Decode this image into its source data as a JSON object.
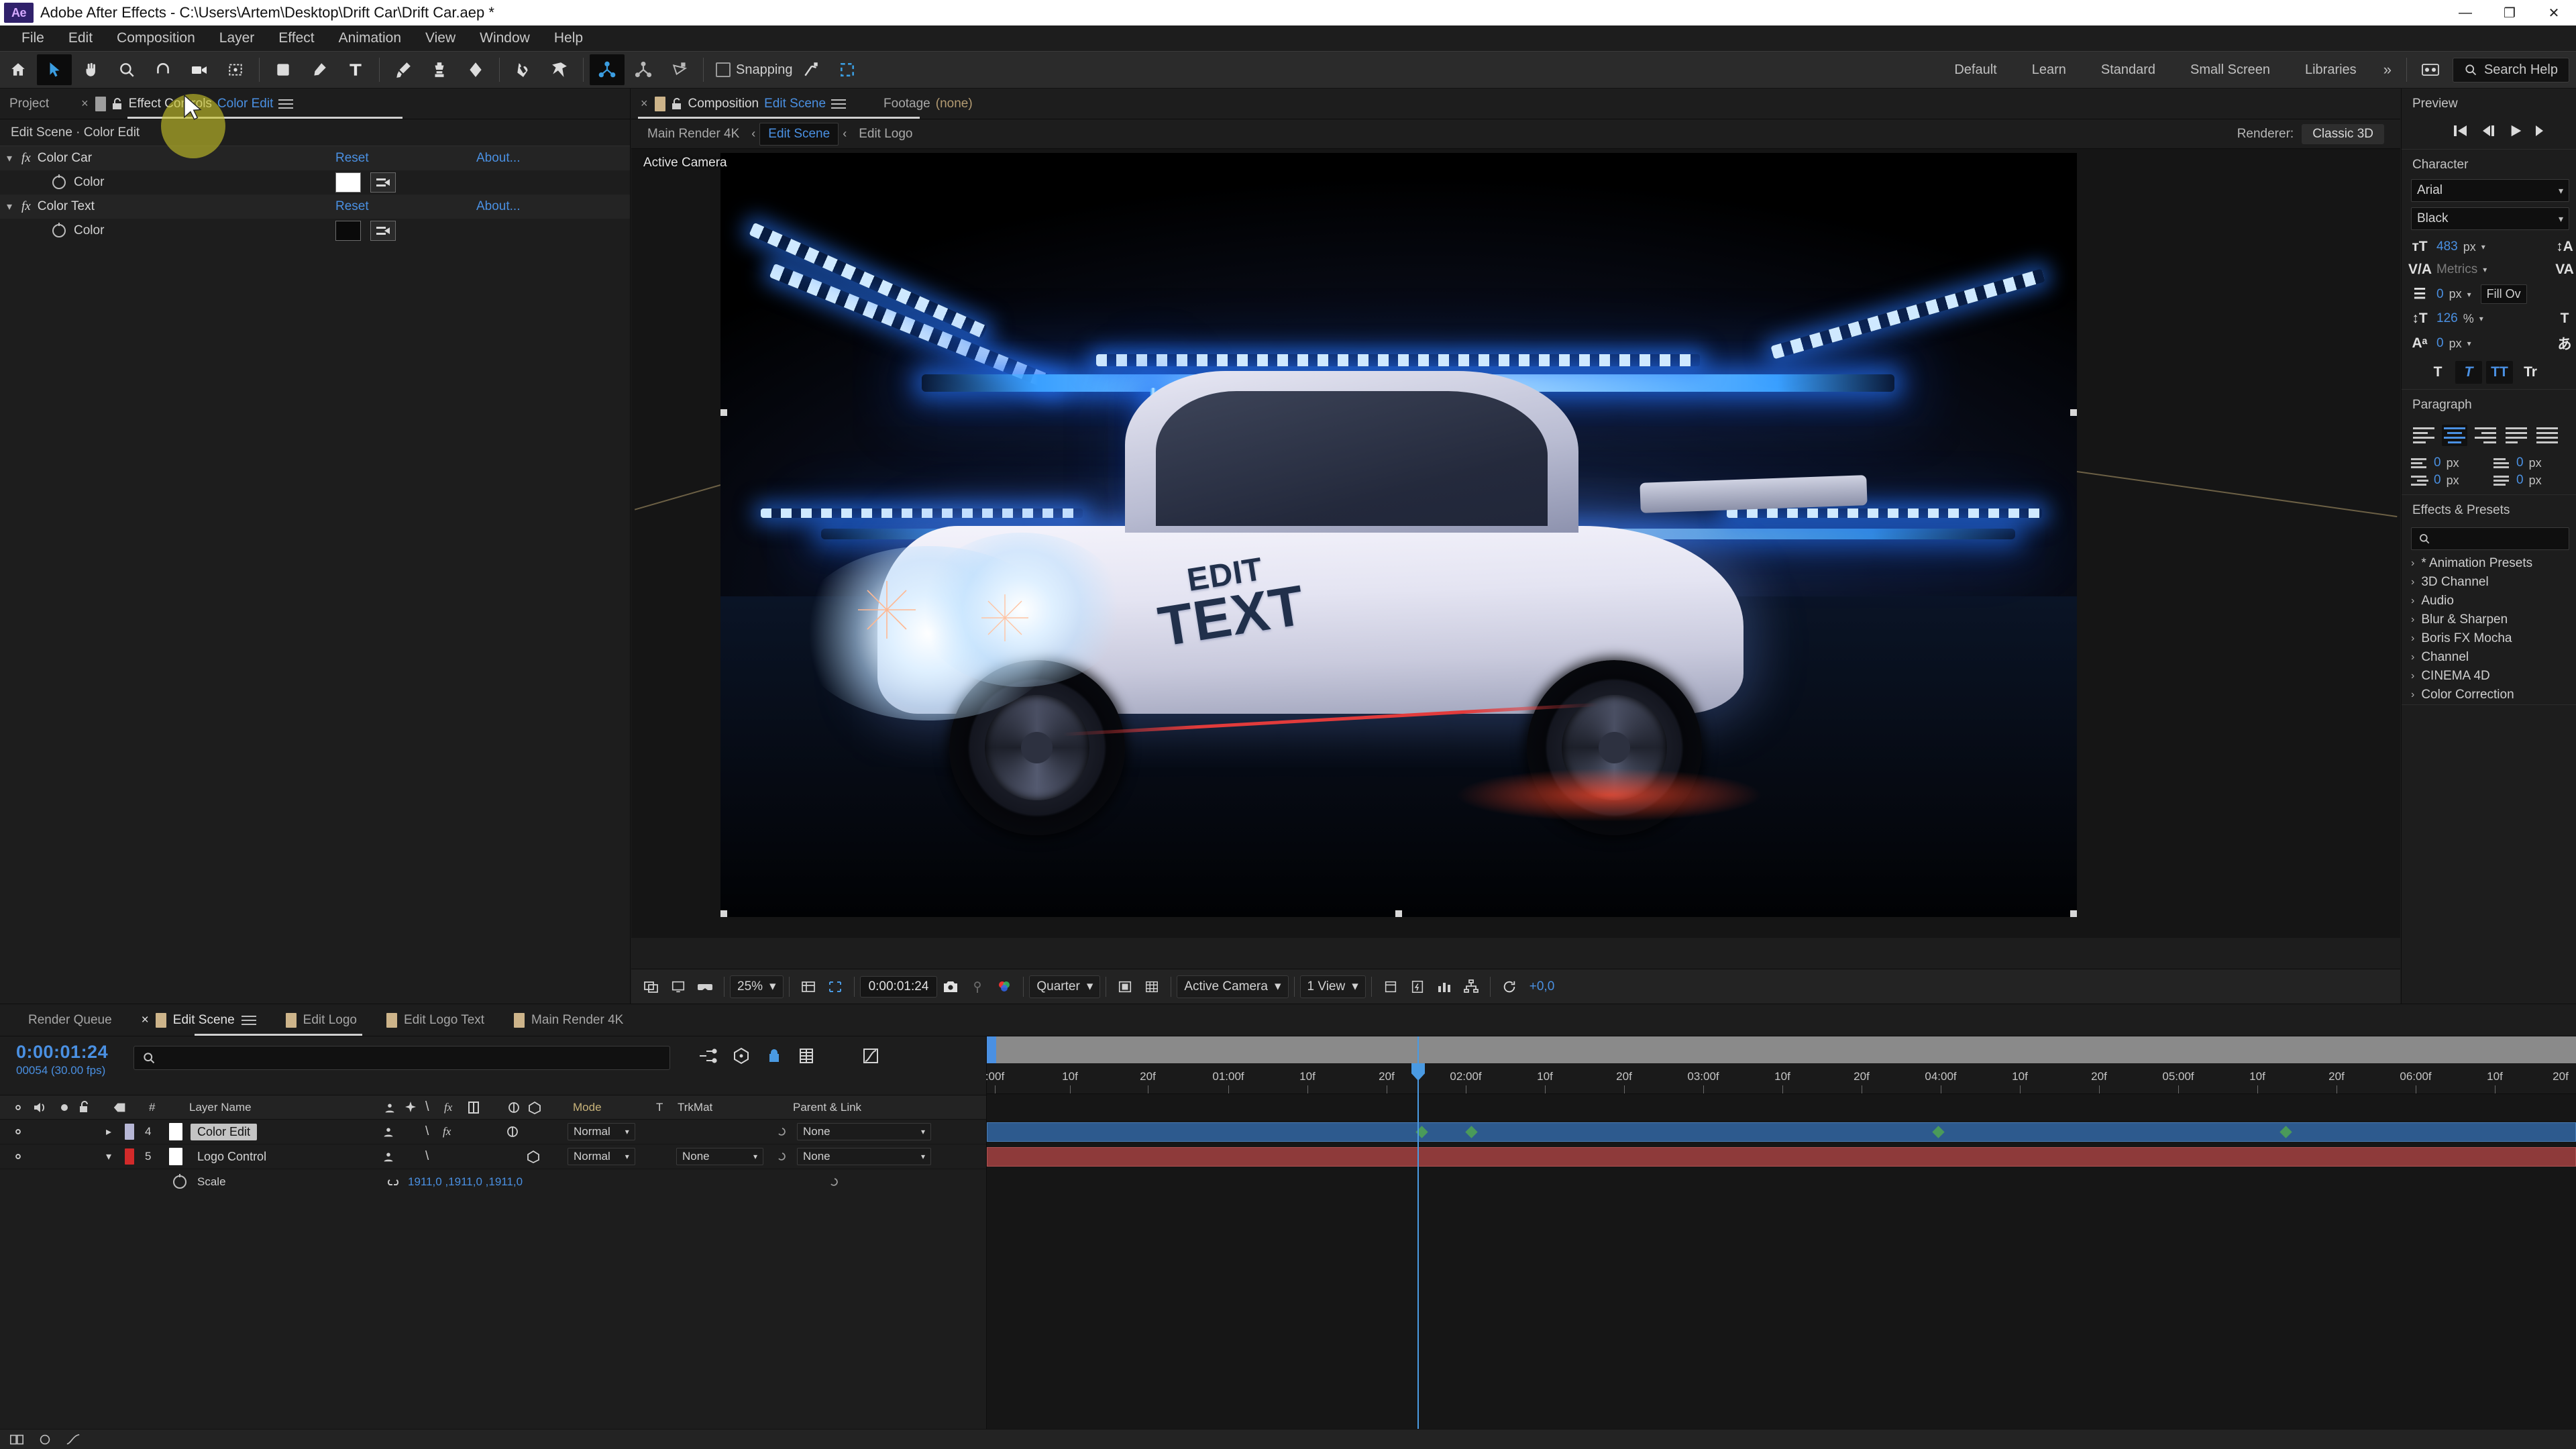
{
  "window": {
    "title": "Adobe After Effects - C:\\Users\\Artem\\Desktop\\Drift Car\\Drift Car.aep *",
    "logo": "Ae",
    "minimize": "—",
    "maximize": "❐",
    "close": "✕"
  },
  "menu": {
    "items": [
      "File",
      "Edit",
      "Composition",
      "Layer",
      "Effect",
      "Animation",
      "View",
      "Window",
      "Help"
    ]
  },
  "toolbar": {
    "snapping_label": "Snapping",
    "workspaces": [
      "Default",
      "Learn",
      "Standard",
      "Small Screen",
      "Libraries"
    ],
    "overflow": "»",
    "search_help": "Search Help"
  },
  "effect_controls": {
    "tabs": [
      {
        "label": "Project",
        "active": false
      },
      {
        "label": "Effect Controls",
        "suffix": "Color Edit",
        "active": true
      }
    ],
    "close_x": "×",
    "breadcrumb": "Edit Scene · Color Edit",
    "effects": [
      {
        "name": "Color Car",
        "fx": "fx",
        "reset": "Reset",
        "about": "About...",
        "property": {
          "name": "Color",
          "swatch": "#ffffff"
        }
      },
      {
        "name": "Color Text",
        "fx": "fx",
        "reset": "Reset",
        "about": "About...",
        "property": {
          "name": "Color",
          "swatch": "#0a0a0a"
        }
      }
    ]
  },
  "composition": {
    "tabs": [
      {
        "label": "Composition",
        "suffix": "Edit Scene",
        "active": true
      },
      {
        "label": "Footage",
        "suffix": "(none)",
        "active": false
      }
    ],
    "close_x": "×",
    "breadcrumb": [
      {
        "label": "Main Render 4K",
        "active": false
      },
      {
        "label": "Edit Scene",
        "active": true
      },
      {
        "label": "Edit Logo",
        "active": false
      }
    ],
    "breadcrumb_sep": "‹",
    "renderer_label": "Renderer:",
    "renderer_value": "Classic 3D",
    "view_label": "Active Camera",
    "car_text_line1": "EDIT",
    "car_text_line2": "TEXT",
    "bottom_bar": {
      "zoom": "25%",
      "time": "0:00:01:24",
      "resolution": "Quarter",
      "camera": "Active Camera",
      "views": "1 View",
      "offset": "+0,0"
    }
  },
  "right_panel": {
    "preview_title": "Preview",
    "character_title": "Character",
    "paragraph_title": "Paragraph",
    "effects_title": "Effects & Presets",
    "font_family": "Arial",
    "font_style": "Black",
    "font_size": "483",
    "font_size_unit": "px",
    "kerning": "Metrics",
    "leading": "0",
    "leading_unit": "px",
    "fill_over": "Fill Ov",
    "vscale": "126",
    "vscale_unit": "%",
    "baseline": "0",
    "baseline_unit": "px",
    "text_style_buttons": [
      "T",
      "T",
      "TT",
      "Tr"
    ],
    "indent_left": "0",
    "indent_right": "0",
    "space_before": "0",
    "space_after": "0",
    "indent_unit": "px",
    "effects_list": [
      "* Animation Presets",
      "3D Channel",
      "Audio",
      "Blur & Sharpen",
      "Boris FX Mocha",
      "Channel",
      "CINEMA 4D",
      "Color Correction"
    ],
    "chevron": "›"
  },
  "timeline": {
    "tabs": [
      {
        "label": "Render Queue",
        "active": false,
        "swatch": false
      },
      {
        "label": "Edit Scene",
        "active": true,
        "swatch": true
      },
      {
        "label": "Edit Logo",
        "active": false,
        "swatch": true
      },
      {
        "label": "Edit Logo Text",
        "active": false,
        "swatch": true
      },
      {
        "label": "Main Render 4K",
        "active": false,
        "swatch": true
      }
    ],
    "close_x": "×",
    "current_time": "0:00:01:24",
    "frame_info": "00054 (30.00 fps)",
    "search_placeholder": "",
    "columns": {
      "number": "#",
      "layer_name": "Layer Name",
      "mode": "Mode",
      "t": "T",
      "trkmat": "TrkMat",
      "parent": "Parent & Link"
    },
    "layers": [
      {
        "index": "4",
        "name": "Color Edit",
        "mode": "Normal",
        "trkmat": "",
        "parent": "None",
        "chip": "#b7b7d6",
        "selected": true
      },
      {
        "index": "5",
        "name": "Logo Control",
        "mode": "Normal",
        "trkmat": "None",
        "parent": "None",
        "chip": "#d22a2a",
        "selected": false
      }
    ],
    "property": {
      "name": "Scale",
      "value": "1911,0 ,1911,0 ,1911,0"
    },
    "ruler_ticks": [
      ":00f",
      "10f",
      "20f",
      "01:00f",
      "10f",
      "20f",
      "02:00f",
      "10f",
      "20f",
      "03:00f",
      "10f",
      "20f",
      "04:00f",
      "10f",
      "20f",
      "05:00f",
      "10f",
      "20f",
      "06:00f",
      "10f",
      "20f"
    ]
  },
  "colors": {
    "accent_blue": "#4a90e2",
    "panel_bg": "#1d1d1d",
    "toolbar_bg": "#2b2b2b",
    "highlight_yellow": "#c8c428"
  }
}
